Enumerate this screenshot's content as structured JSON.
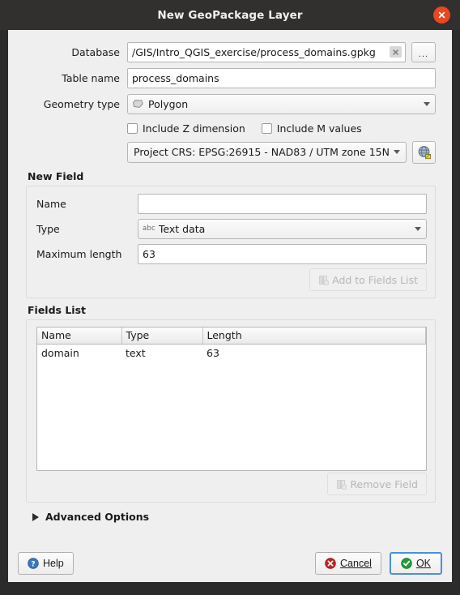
{
  "titlebar": {
    "title": "New GeoPackage Layer",
    "close_icon": "close-icon"
  },
  "form": {
    "database": {
      "label": "Database",
      "value": "/GIS/Intro_QGIS_exercise/process_domains.gpkg",
      "clear_icon": "clear-icon",
      "browse_label": "..."
    },
    "table_name": {
      "label": "Table name",
      "value": "process_domains"
    },
    "geometry_type": {
      "label": "Geometry type",
      "value": "Polygon",
      "icon": "polygon-icon"
    },
    "include_z": {
      "label": "Include Z dimension",
      "checked": false
    },
    "include_m": {
      "label": "Include M values",
      "checked": false
    },
    "crs": {
      "value": "Project CRS: EPSG:26915 - NAD83 / UTM zone 15N",
      "select_icon": "globe-edit-icon"
    }
  },
  "new_field": {
    "group_title": "New Field",
    "name": {
      "label": "Name",
      "value": ""
    },
    "type": {
      "label": "Type",
      "value": "Text data",
      "icon": "abc-text-icon"
    },
    "max_length": {
      "label": "Maximum length",
      "value": "63"
    },
    "add_button": {
      "label": "Add to Fields List",
      "enabled": false,
      "icon": "add-field-icon"
    }
  },
  "fields_list": {
    "group_title": "Fields List",
    "columns": [
      "Name",
      "Type",
      "Length"
    ],
    "rows": [
      {
        "name": "domain",
        "type": "text",
        "length": "63"
      }
    ],
    "remove_button": {
      "label": "Remove Field",
      "enabled": false,
      "icon": "remove-field-icon"
    }
  },
  "advanced_options": {
    "label": "Advanced Options",
    "expanded": false,
    "icon": "chevron-right-icon"
  },
  "footer": {
    "help": {
      "label": "Help",
      "icon": "help-icon"
    },
    "cancel": {
      "label": "Cancel",
      "icon": "cancel-icon"
    },
    "ok": {
      "label": "OK",
      "icon": "ok-icon"
    }
  },
  "colors": {
    "close_button": "#e8471f",
    "titlebar": "#32302f",
    "dialog_bg": "#efefef",
    "focus_border": "#4a90d9",
    "cancel_icon": "#c9211e",
    "ok_icon": "#1e9e36",
    "help_icon": "#3a76c4"
  }
}
